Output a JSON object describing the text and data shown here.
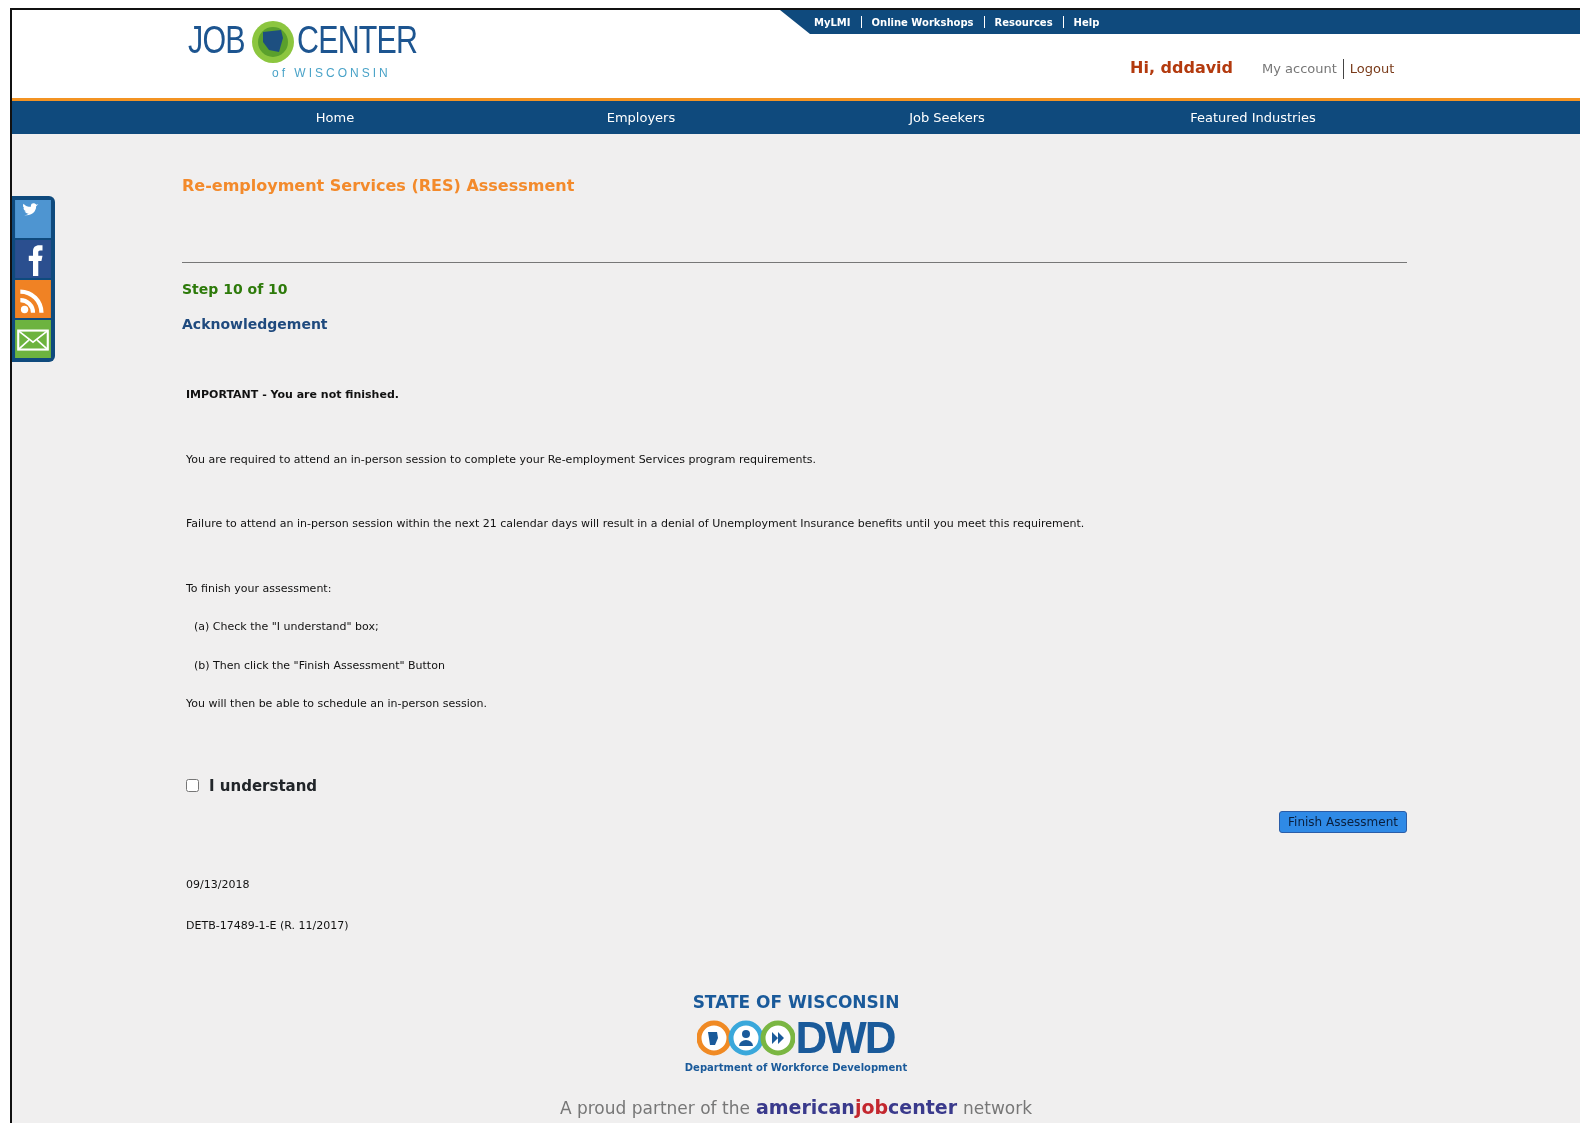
{
  "top_links": [
    "MyLMI",
    "Online Workshops",
    "Resources",
    "Help"
  ],
  "logo": {
    "word1": "JOB",
    "word2": "CENTER",
    "tagline": "of WISCONSIN"
  },
  "greeting": "Hi, dddavid",
  "account_links": [
    "My account",
    "Logout"
  ],
  "nav": [
    "Home",
    "Employers",
    "Job Seekers",
    "Featured Industries"
  ],
  "social": [
    {
      "kind": "twitter"
    },
    {
      "kind": "facebook"
    },
    {
      "kind": "rss"
    },
    {
      "kind": "email"
    }
  ],
  "page_title": "Re-employment Services (RES) Assessment",
  "step": "Step 10 of 10",
  "section": "Acknowledgement",
  "paragraphs": [
    {
      "text": "IMPORTANT - You are not finished.",
      "kind": "bold"
    },
    {
      "text": "You are required to attend an in-person session to complete your Re-employment Services program requirements.",
      "kind": "plain"
    },
    {
      "text": "Failure to attend an in-person session within the next 21 calendar days will result in a denial of Unemployment Insurance benefits until you meet this requirement.",
      "kind": "plain"
    },
    {
      "text": "To finish your assessment:",
      "kind": "plain"
    },
    {
      "text": "(a) Check the \"I understand\" box;",
      "kind": "indent"
    },
    {
      "text": "(b) Then click the \"Finish Assessment\" Button",
      "kind": "indent"
    },
    {
      "text": "You will then be able to schedule an in-person session.",
      "kind": "plain"
    }
  ],
  "understand": {
    "label": "I understand",
    "checked": false
  },
  "finish_button": {
    "label": "Finish Assessment",
    "disabled": true
  },
  "date": "09/13/2018",
  "form_id": "DETB-17489-1-E (R. 11/2017)",
  "footer": {
    "state": "STATE OF WISCONSIN",
    "agency": "DWD",
    "agency_full": "Department of Workforce Development",
    "partner_text": "A proud partner of the",
    "ajc": [
      "american",
      "job",
      "center"
    ],
    "ajc_suffix": "network"
  }
}
